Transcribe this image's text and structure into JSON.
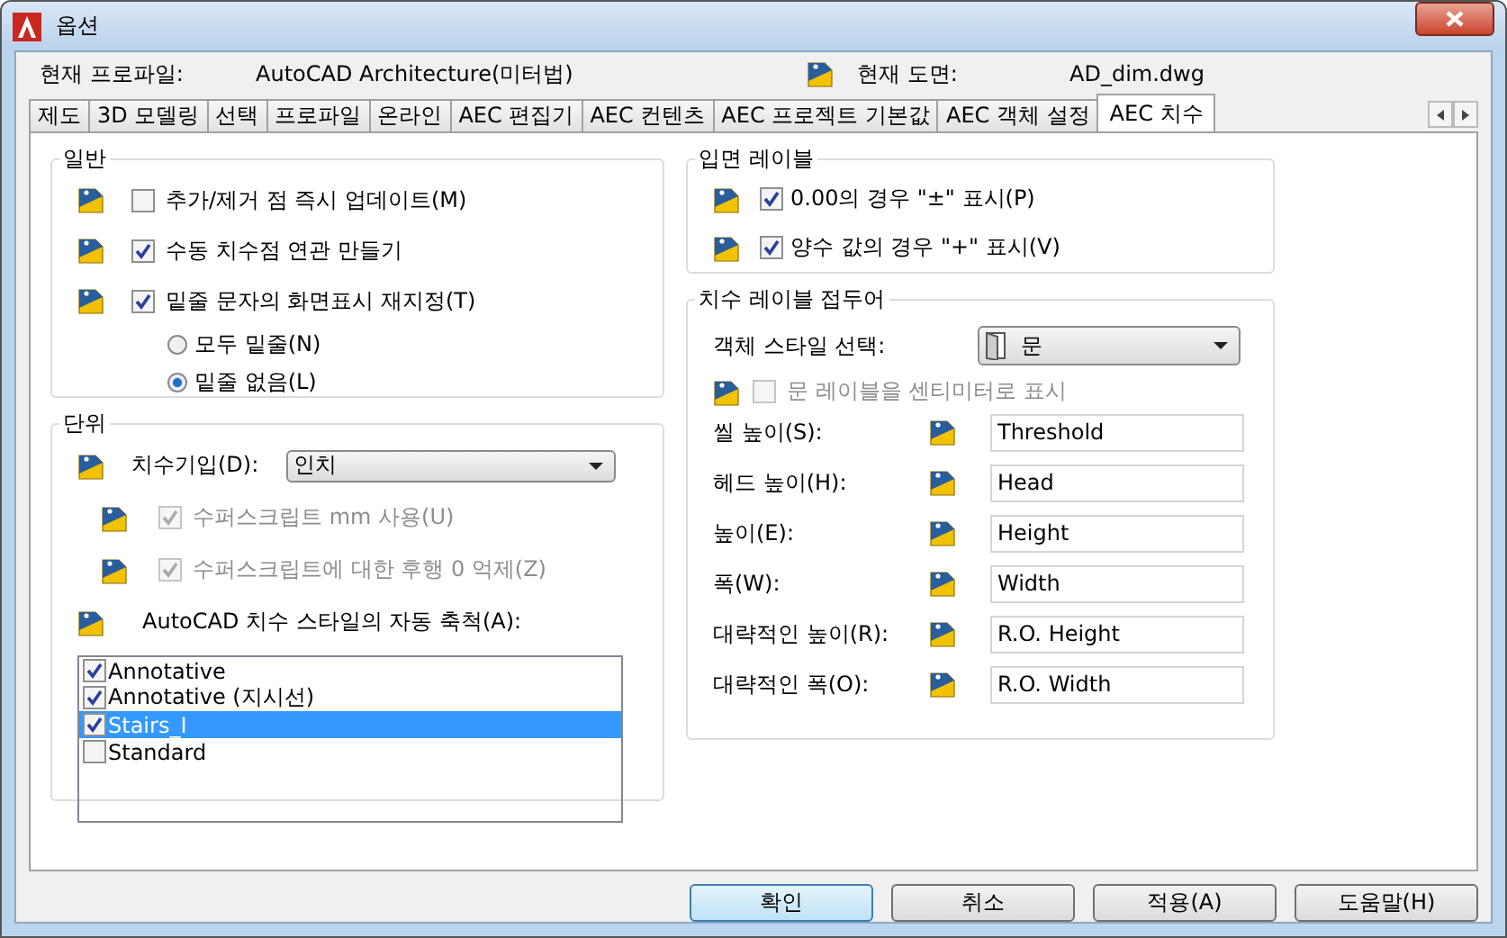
{
  "window": {
    "title": "옵션"
  },
  "current_profile": {
    "label": "현재 프로파일:",
    "value": "AutoCAD Architecture(미터법)"
  },
  "current_drawing": {
    "label": "현재 도면:",
    "value": "AD_dim.dwg"
  },
  "tabs": [
    {
      "label": "제도",
      "selected": false
    },
    {
      "label": "3D 모델링",
      "selected": false
    },
    {
      "label": "선택",
      "selected": false
    },
    {
      "label": "프로파일",
      "selected": false
    },
    {
      "label": "온라인",
      "selected": false
    },
    {
      "label": "AEC 편집기",
      "selected": false
    },
    {
      "label": "AEC 컨텐츠",
      "selected": false
    },
    {
      "label": "AEC 프로젝트 기본값",
      "selected": false
    },
    {
      "label": "AEC 객체 설정",
      "selected": false
    },
    {
      "label": "AEC 치수",
      "selected": true
    }
  ],
  "general": {
    "title": "일반",
    "checkboxes": [
      {
        "label": "추가/제거 점 즉시 업데이트(M)",
        "checked": false,
        "disabled": false
      },
      {
        "label": "수동 치수점 연관 만들기",
        "checked": true,
        "disabled": false
      },
      {
        "label": "밑줄 문자의 화면표시 재지정(T)",
        "checked": true,
        "disabled": false
      }
    ],
    "radios": [
      {
        "label": "모두 밑줄(N)",
        "selected": false
      },
      {
        "label": "밑줄 없음(L)",
        "selected": true
      }
    ]
  },
  "units": {
    "title": "단위",
    "dim_units": {
      "label": "치수기입(D):",
      "value": "인치"
    },
    "checkboxes": [
      {
        "label": "수퍼스크립트 mm 사용(U)",
        "checked": true,
        "disabled": true
      },
      {
        "label": "수퍼스크립트에 대한 후행 0 억제(Z)",
        "checked": true,
        "disabled": true
      }
    ],
    "auto_scale_label": "AutoCAD 치수 스타일의 자동 축척(A):",
    "styles": [
      {
        "label": "Annotative",
        "checked": true,
        "selected": false
      },
      {
        "label": "Annotative (지시선)",
        "checked": true,
        "selected": false
      },
      {
        "label": "Stairs_I",
        "checked": true,
        "selected": true
      },
      {
        "label": "Standard",
        "checked": false,
        "selected": false
      }
    ]
  },
  "elevation_labels": {
    "title": "입면 레이블",
    "checkboxes": [
      {
        "label": "0.00의 경우 \"±\" 표시(P)",
        "checked": true,
        "disabled": false
      },
      {
        "label": "양수 값의 경우 \"+\" 표시(V)",
        "checked": true,
        "disabled": false
      }
    ]
  },
  "dim_label_prefixes": {
    "title": "치수 레이블 접두어",
    "style_select": {
      "label": "객체 스타일 선택:",
      "value": "문"
    },
    "checkbox": {
      "label": "문 레이블을 센티미터로 표시",
      "checked": false,
      "disabled": true
    },
    "fields": [
      {
        "label": "씰 높이(S):",
        "value": "Threshold"
      },
      {
        "label": "헤드 높이(H):",
        "value": "Head"
      },
      {
        "label": "높이(E):",
        "value": "Height"
      },
      {
        "label": "폭(W):",
        "value": "Width"
      },
      {
        "label": "대략적인 높이(R):",
        "value": "R.O. Height"
      },
      {
        "label": "대략적인 폭(O):",
        "value": "R.O. Width"
      }
    ]
  },
  "buttons": [
    {
      "label": "확인",
      "default": true
    },
    {
      "label": "취소",
      "default": false
    },
    {
      "label": "적용(A)",
      "default": false
    },
    {
      "label": "도움말(H)",
      "default": false
    }
  ]
}
